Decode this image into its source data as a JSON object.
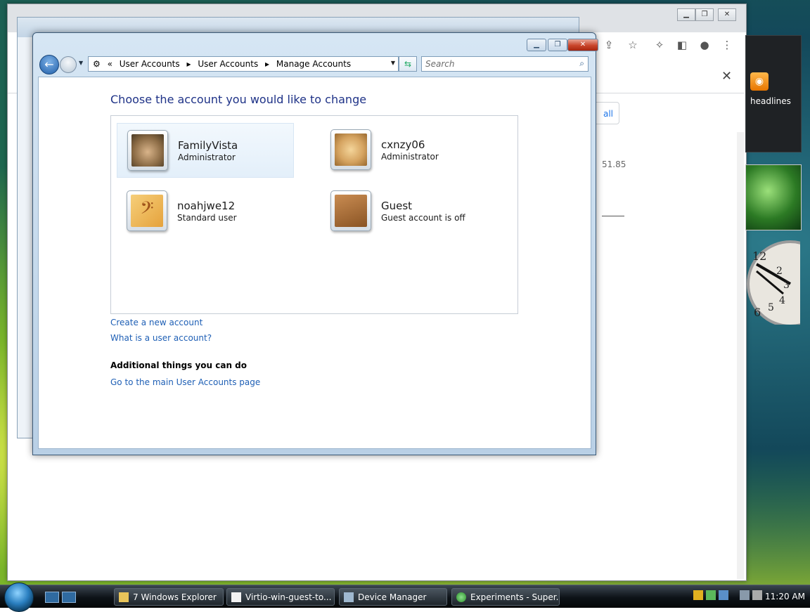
{
  "window": {
    "breadcrumb": [
      "User Accounts",
      "User Accounts",
      "Manage Accounts"
    ],
    "search_placeholder": "Search"
  },
  "main": {
    "heading": "Choose the account you would like to change",
    "accounts": [
      {
        "name": "FamilyVista",
        "type": "Administrator",
        "picture": "kitten"
      },
      {
        "name": "cxnzy06",
        "type": "Administrator",
        "picture": "puppy"
      },
      {
        "name": "noahjwe12",
        "type": "Standard user",
        "picture": "bass-clef"
      },
      {
        "name": "Guest",
        "type": "Guest account is off",
        "picture": "briefcase"
      }
    ],
    "links": {
      "create": "Create a new account",
      "what_is": "What is a user account?"
    },
    "additional_heading": "Additional things you can do",
    "additional_links": [
      "Go to the main User Accounts page"
    ]
  },
  "background_browser": {
    "all_label": "all",
    "number_fragment": "51.85"
  },
  "gadgets": {
    "rss_text": "headlines"
  },
  "taskbar": {
    "buttons": [
      {
        "label": "7 Windows Explorer",
        "icon": "folder-icon"
      },
      {
        "label": "Virtio-win-guest-to...",
        "icon": "document-icon"
      },
      {
        "label": "Device Manager",
        "icon": "computer-icon"
      },
      {
        "label": "Experiments - Super...",
        "icon": "browser-icon"
      }
    ],
    "clock": "11:20 AM"
  },
  "colors": {
    "heading": "#1e3287",
    "link": "#1e5fb5",
    "window_frame": "#b9d0e6"
  }
}
